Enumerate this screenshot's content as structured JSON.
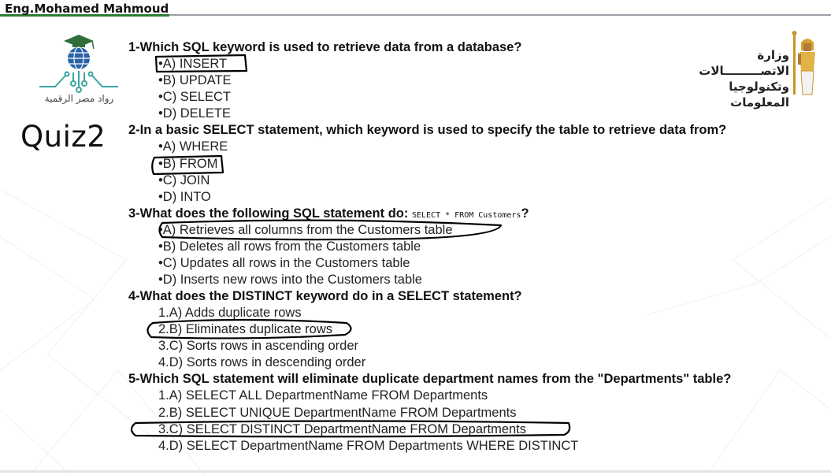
{
  "header": {
    "author": "Eng.Mohamed Mahmoud"
  },
  "left_logo": {
    "caption": "رواد مصر الرقمية"
  },
  "ministry": {
    "line1": "وزارة الاتصـــــــــالات",
    "line2": "وتكنولوجيا المعلومات"
  },
  "quiz_title": "Quiz2",
  "questions": [
    {
      "text": "1-Which SQL keyword is used to retrieve data from a database?",
      "options": [
        "•A) INSERT",
        "•B) UPDATE",
        "•C) SELECT",
        "•D) DELETE"
      ],
      "marked": 0
    },
    {
      "text": "2-In a basic SELECT statement, which keyword is used to specify the table to retrieve data from?",
      "options": [
        "•A) WHERE",
        "•B) FROM",
        "•C) JOIN",
        "•D) INTO"
      ],
      "marked": 1
    },
    {
      "text": "3-What does the following SQL statement do:",
      "code": "SELECT * FROM Customers",
      "suffix": "?",
      "options": [
        "•A) Retrieves all columns from the Customers table",
        "•B) Deletes all rows from the Customers table",
        "•C) Updates all rows in the Customers table",
        "•D) Inserts new rows into the Customers table"
      ],
      "marked": 0
    },
    {
      "text": "4-What does the DISTINCT keyword do in a SELECT statement?",
      "options": [
        "1.A) Adds duplicate rows",
        "2.B) Eliminates duplicate rows",
        "3.C) Sorts rows in ascending order",
        "4.D) Sorts rows in descending order"
      ],
      "marked": 1
    },
    {
      "text": "5-Which SQL statement will eliminate duplicate department names from the \"Departments\" table?",
      "options": [
        "1.A) SELECT ALL DepartmentName FROM Departments",
        "2.B) SELECT UNIQUE DepartmentName FROM Departments",
        "3.C) SELECT DISTINCT DepartmentName FROM Departments",
        "4.D) SELECT DepartmentName FROM Departments WHERE DISTINCT"
      ],
      "marked": 2
    }
  ]
}
